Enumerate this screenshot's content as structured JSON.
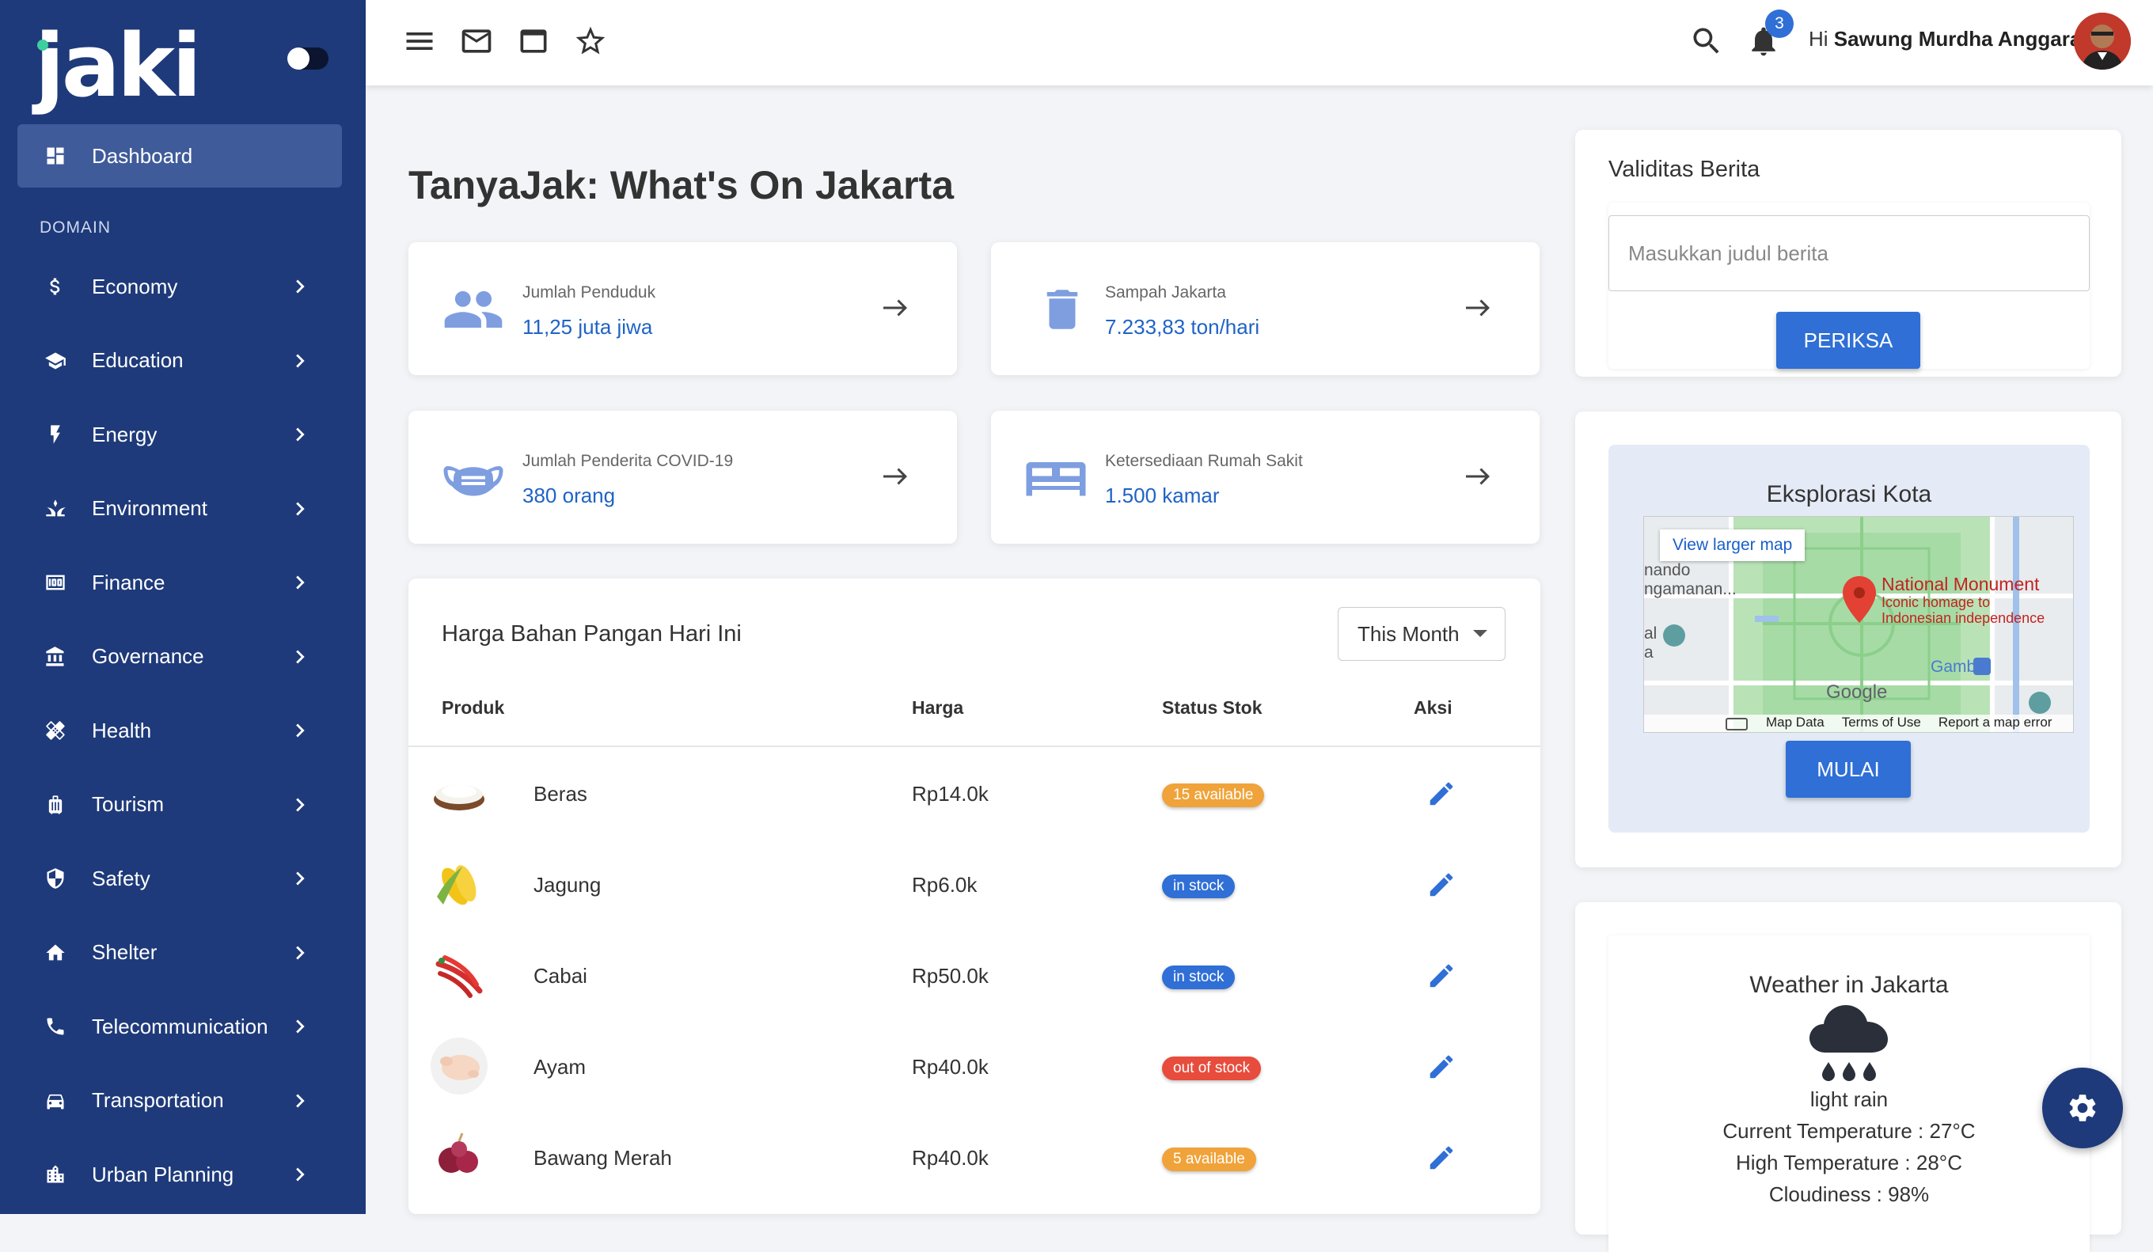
{
  "app": {
    "logo_text": "jaki",
    "logo_dot_color": "#3ccf9e",
    "brand_color": "#1e3a7a",
    "accent_color": "#2f6fd6"
  },
  "sidebar": {
    "dashboard_label": "Dashboard",
    "domain_title": "DOMAIN",
    "items": [
      {
        "label": "Economy",
        "icon": "dollar-icon"
      },
      {
        "label": "Education",
        "icon": "graduation-cap-icon"
      },
      {
        "label": "Energy",
        "icon": "lightning-icon"
      },
      {
        "label": "Environment",
        "icon": "grass-icon"
      },
      {
        "label": "Finance",
        "icon": "money-icon"
      },
      {
        "label": "Governance",
        "icon": "bank-icon"
      },
      {
        "label": "Health",
        "icon": "healing-icon"
      },
      {
        "label": "Tourism",
        "icon": "luggage-icon"
      },
      {
        "label": "Safety",
        "icon": "shield-icon"
      },
      {
        "label": "Shelter",
        "icon": "home-icon"
      },
      {
        "label": "Telecommunication",
        "icon": "phone-icon"
      },
      {
        "label": "Transportation",
        "icon": "car-icon"
      },
      {
        "label": "Urban Planning",
        "icon": "city-icon"
      }
    ]
  },
  "topbar": {
    "icons": [
      "menu-icon",
      "mail-icon",
      "window-icon",
      "star-icon"
    ],
    "notification_count": "3",
    "greeting": "Hi",
    "user_name": "Sawung Murdha Anggara"
  },
  "main": {
    "title": "TanyaJak: What's On Jakarta",
    "stats": [
      {
        "label": "Jumlah Penduduk",
        "value": "11,25 juta jiwa",
        "icon": "people-icon"
      },
      {
        "label": "Sampah Jakarta",
        "value": "7.233,83 ton/hari",
        "icon": "trash-icon"
      },
      {
        "label": "Jumlah Penderita COVID-19",
        "value": "380 orang",
        "icon": "mask-icon"
      },
      {
        "label": "Ketersediaan Rumah Sakit",
        "value": "1.500 kamar",
        "icon": "bed-icon"
      }
    ],
    "food_table": {
      "title": "Harga Bahan Pangan Hari Ini",
      "filter": "This Month",
      "columns": [
        "Produk",
        "Harga",
        "Status Stok",
        "Aksi"
      ],
      "rows": [
        {
          "name": "Beras",
          "price": "Rp14.0k",
          "status": "15 available",
          "status_color": "#f0a33a"
        },
        {
          "name": "Jagung",
          "price": "Rp6.0k",
          "status": "in stock",
          "status_color": "#2f6fd6"
        },
        {
          "name": "Cabai",
          "price": "Rp50.0k",
          "status": "in stock",
          "status_color": "#2f6fd6"
        },
        {
          "name": "Ayam",
          "price": "Rp40.0k",
          "status": "out of stock",
          "status_color": "#e74c3c"
        },
        {
          "name": "Bawang Merah",
          "price": "Rp40.0k",
          "status": "5 available",
          "status_color": "#f0a33a"
        }
      ]
    }
  },
  "validitas": {
    "title": "Validitas Berita",
    "placeholder": "Masukkan judul berita",
    "button": "PERIKSA"
  },
  "eksplorasi": {
    "title": "Eksplorasi Kota",
    "button": "MULAI",
    "map": {
      "view_larger": "View larger map",
      "place_name": "National Monument",
      "place_desc_1": "Iconic homage to",
      "place_desc_2": "Indonesian independence",
      "station": "Gambir",
      "left_text_1": "nando",
      "left_text_2": "ngamanan...",
      "left_text_3": "al",
      "left_text_4": "a",
      "google": "Google",
      "footer": [
        "Map Data",
        "Terms of Use",
        "Report a map error"
      ]
    }
  },
  "weather": {
    "title": "Weather in Jakarta",
    "description": "light rain",
    "current": "Current Temperature : 27°C",
    "high": "High Temperature : 28°C",
    "cloudiness": "Cloudiness : 98%"
  }
}
